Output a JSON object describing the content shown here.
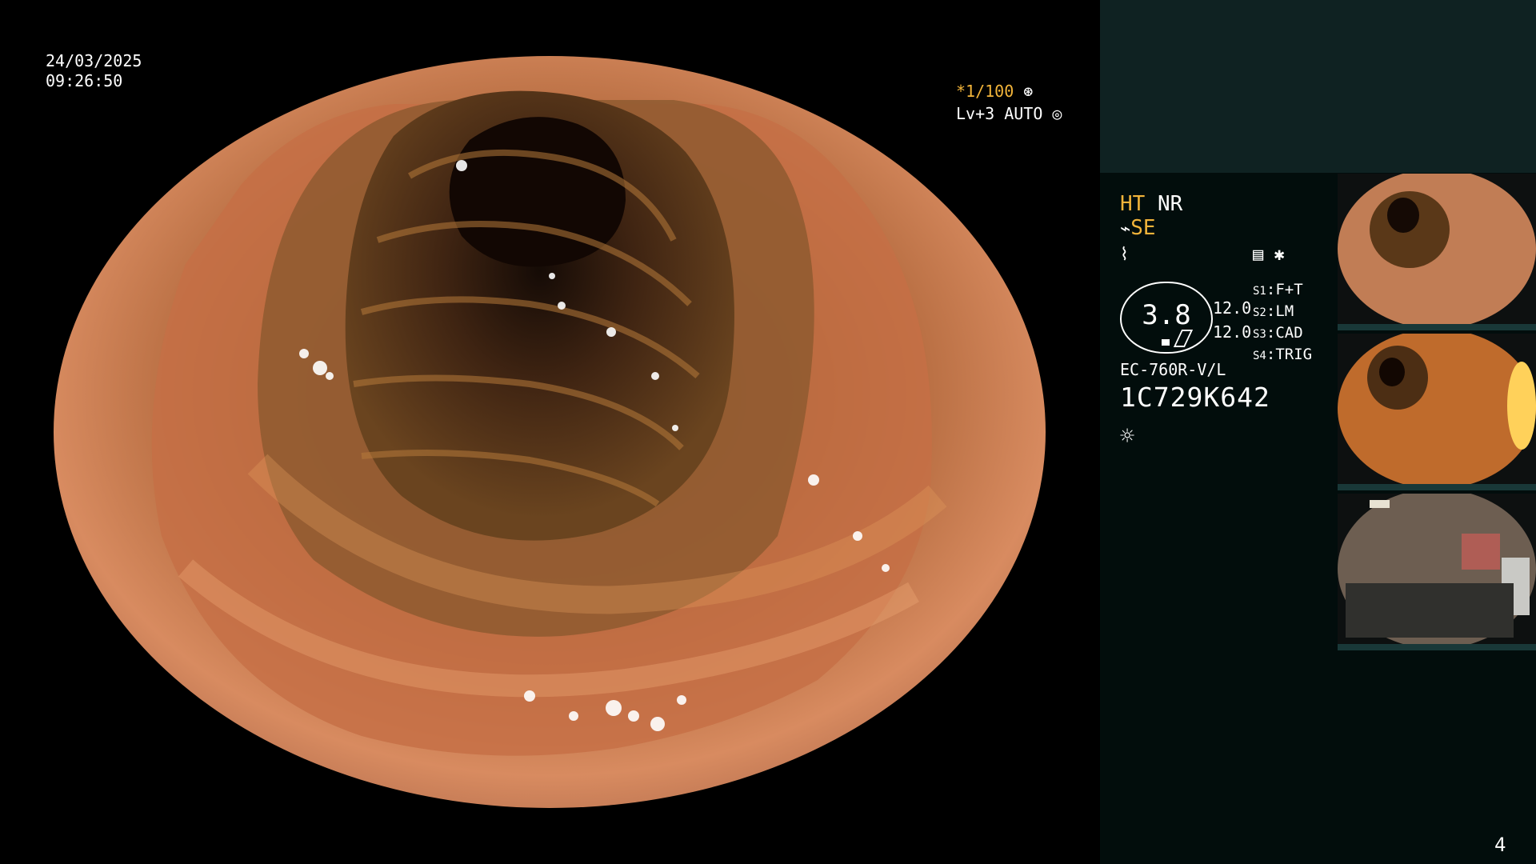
{
  "overlay": {
    "date": "24/03/2025",
    "time": "09:26:50",
    "shutter": "*1/100",
    "level": "Lv+3 AUTO"
  },
  "side": {
    "ht": "HT",
    "nr": "NR",
    "se": "SE",
    "gauge_value": "3.8",
    "settings": [
      "12.0",
      "12.0"
    ],
    "slots": [
      {
        "key": "S1",
        "value": "F+T"
      },
      {
        "key": "S2",
        "value": "LM"
      },
      {
        "key": "S3",
        "value": "CAD"
      },
      {
        "key": "S4",
        "value": "TRIG"
      }
    ],
    "model": "EC-760R-V/L",
    "serial": "1C729K642",
    "page_number": "4",
    "icons": [
      "camera-icon",
      "star-icon",
      "brightness-icon"
    ]
  }
}
